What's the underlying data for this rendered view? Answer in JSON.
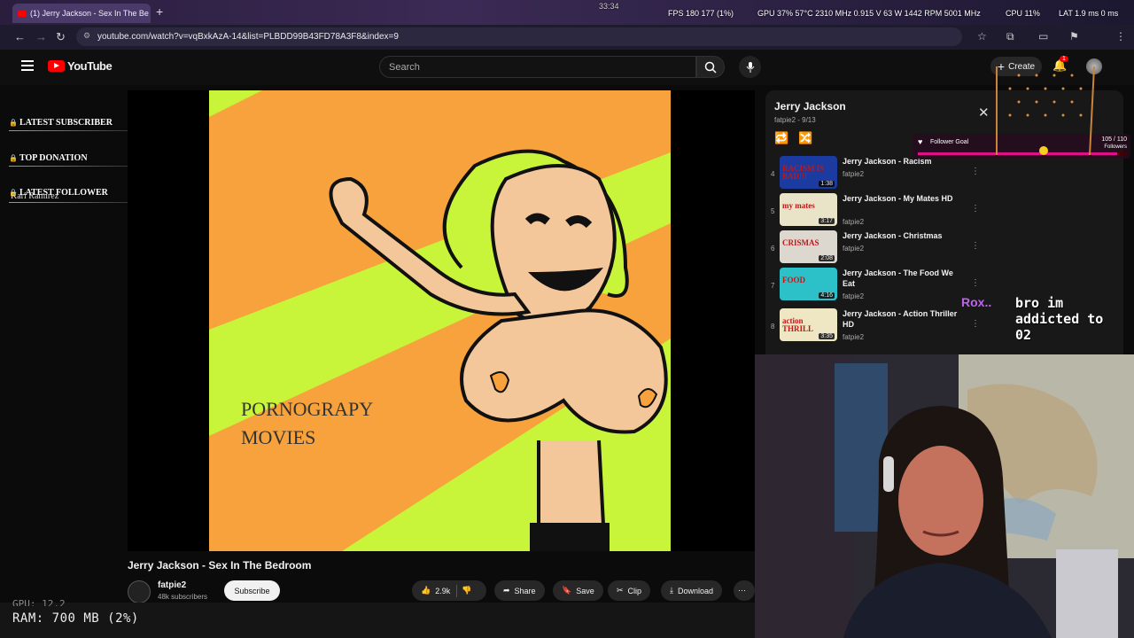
{
  "browser": {
    "tab_title": "(1) Jerry Jackson - Sex In The Be",
    "url": "youtube.com/watch?v=vqBxkAzA-14&list=PLBDD99B43FD78A3F8&index=9"
  },
  "osd": {
    "fps": "FPS 180  177 (1%)",
    "gpu": "GPU 37% 57°C 2310 MHz 0.915 V 63 W 1442 RPM 5001 MHz",
    "cpu": "CPU 11%",
    "lat": "LAT 1.9 ms 0 ms",
    "clock": "33:34"
  },
  "youtube": {
    "logo": "YouTube",
    "search_placeholder": "Search",
    "create_label": "Create",
    "notif_count": "1"
  },
  "overlay": {
    "latest_subscriber": "LATEST SUBSCRIBER",
    "top_donation": "TOP DONATION",
    "latest_follower": "LATEST FOLLOWER",
    "follower_name": "Kari Ramirez",
    "ram": "RAM: 700 MB (2%)",
    "gpu_partial": "GPU: 12.2",
    "follower_goal_label": "Follower Goal",
    "follower_goal_count": "105 / 110",
    "follower_goal_unit": "Followers",
    "follower_goal_progress": 0.9545
  },
  "video": {
    "title": "Jerry Jackson - Sex In The Bedroom",
    "thumbnail_caption_line1": "PORNOGRAPY",
    "thumbnail_caption_line2": "MOVIES",
    "channel": "fatpie2",
    "subscribers": "48k subscribers",
    "subscribe_label": "Subscribe",
    "likes": "2.9k",
    "share_label": "Share",
    "save_label": "Save",
    "clip_label": "Clip",
    "download_label": "Download"
  },
  "playlist": {
    "title": "Jerry Jackson",
    "subtitle": "fatpie2 - 9/13",
    "items": [
      {
        "index": "4",
        "title": "Jerry Jackson - Racism",
        "channel": "fatpie2",
        "duration": "1:38",
        "thumb_text": "RACISM IS BAD!!!",
        "thumb_bg": "#1b3ba0"
      },
      {
        "index": "5",
        "title": "Jerry Jackson - My Mates HD",
        "channel": "fatpie2",
        "duration": "3:17",
        "thumb_text": "my mates",
        "thumb_bg": "#e9e3c8"
      },
      {
        "index": "6",
        "title": "Jerry Jackson - Christmas",
        "channel": "fatpie2",
        "duration": "2:08",
        "thumb_text": "CRISMAS",
        "thumb_bg": "#dcd7cf"
      },
      {
        "index": "7",
        "title": "Jerry Jackson - The Food We Eat",
        "channel": "fatpie2",
        "duration": "4:16",
        "thumb_text": "FOOD",
        "thumb_bg": "#2cc0c8"
      },
      {
        "index": "8",
        "title": "Jerry Jackson - Action Thriller HD",
        "channel": "fatpie2",
        "duration": "3:35",
        "thumb_text": "action THRILL",
        "thumb_bg": "#efe7c4"
      }
    ]
  },
  "chat": {
    "user": "Rox..",
    "message": "bro im addicted to 02"
  },
  "colors": {
    "yt_red": "#ff0000",
    "thumb_orange": "#f7a23c",
    "thumb_green": "#c8f53a",
    "goal_pink": "#e0108a"
  }
}
